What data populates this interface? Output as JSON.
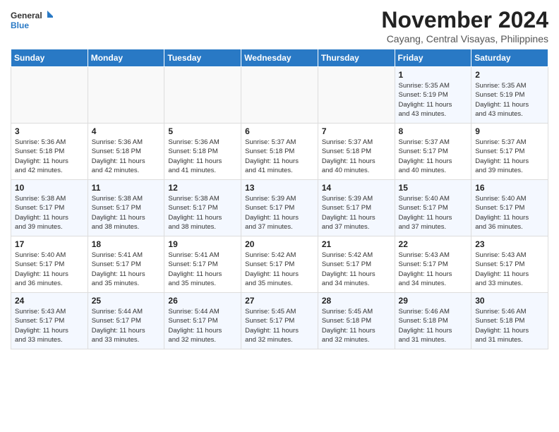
{
  "logo": {
    "line1": "General",
    "line2": "Blue"
  },
  "title": "November 2024",
  "location": "Cayang, Central Visayas, Philippines",
  "weekdays": [
    "Sunday",
    "Monday",
    "Tuesday",
    "Wednesday",
    "Thursday",
    "Friday",
    "Saturday"
  ],
  "weeks": [
    [
      {
        "day": "",
        "info": ""
      },
      {
        "day": "",
        "info": ""
      },
      {
        "day": "",
        "info": ""
      },
      {
        "day": "",
        "info": ""
      },
      {
        "day": "",
        "info": ""
      },
      {
        "day": "1",
        "info": "Sunrise: 5:35 AM\nSunset: 5:19 PM\nDaylight: 11 hours\nand 43 minutes."
      },
      {
        "day": "2",
        "info": "Sunrise: 5:35 AM\nSunset: 5:19 PM\nDaylight: 11 hours\nand 43 minutes."
      }
    ],
    [
      {
        "day": "3",
        "info": "Sunrise: 5:36 AM\nSunset: 5:18 PM\nDaylight: 11 hours\nand 42 minutes."
      },
      {
        "day": "4",
        "info": "Sunrise: 5:36 AM\nSunset: 5:18 PM\nDaylight: 11 hours\nand 42 minutes."
      },
      {
        "day": "5",
        "info": "Sunrise: 5:36 AM\nSunset: 5:18 PM\nDaylight: 11 hours\nand 41 minutes."
      },
      {
        "day": "6",
        "info": "Sunrise: 5:37 AM\nSunset: 5:18 PM\nDaylight: 11 hours\nand 41 minutes."
      },
      {
        "day": "7",
        "info": "Sunrise: 5:37 AM\nSunset: 5:18 PM\nDaylight: 11 hours\nand 40 minutes."
      },
      {
        "day": "8",
        "info": "Sunrise: 5:37 AM\nSunset: 5:17 PM\nDaylight: 11 hours\nand 40 minutes."
      },
      {
        "day": "9",
        "info": "Sunrise: 5:37 AM\nSunset: 5:17 PM\nDaylight: 11 hours\nand 39 minutes."
      }
    ],
    [
      {
        "day": "10",
        "info": "Sunrise: 5:38 AM\nSunset: 5:17 PM\nDaylight: 11 hours\nand 39 minutes."
      },
      {
        "day": "11",
        "info": "Sunrise: 5:38 AM\nSunset: 5:17 PM\nDaylight: 11 hours\nand 38 minutes."
      },
      {
        "day": "12",
        "info": "Sunrise: 5:38 AM\nSunset: 5:17 PM\nDaylight: 11 hours\nand 38 minutes."
      },
      {
        "day": "13",
        "info": "Sunrise: 5:39 AM\nSunset: 5:17 PM\nDaylight: 11 hours\nand 37 minutes."
      },
      {
        "day": "14",
        "info": "Sunrise: 5:39 AM\nSunset: 5:17 PM\nDaylight: 11 hours\nand 37 minutes."
      },
      {
        "day": "15",
        "info": "Sunrise: 5:40 AM\nSunset: 5:17 PM\nDaylight: 11 hours\nand 37 minutes."
      },
      {
        "day": "16",
        "info": "Sunrise: 5:40 AM\nSunset: 5:17 PM\nDaylight: 11 hours\nand 36 minutes."
      }
    ],
    [
      {
        "day": "17",
        "info": "Sunrise: 5:40 AM\nSunset: 5:17 PM\nDaylight: 11 hours\nand 36 minutes."
      },
      {
        "day": "18",
        "info": "Sunrise: 5:41 AM\nSunset: 5:17 PM\nDaylight: 11 hours\nand 35 minutes."
      },
      {
        "day": "19",
        "info": "Sunrise: 5:41 AM\nSunset: 5:17 PM\nDaylight: 11 hours\nand 35 minutes."
      },
      {
        "day": "20",
        "info": "Sunrise: 5:42 AM\nSunset: 5:17 PM\nDaylight: 11 hours\nand 35 minutes."
      },
      {
        "day": "21",
        "info": "Sunrise: 5:42 AM\nSunset: 5:17 PM\nDaylight: 11 hours\nand 34 minutes."
      },
      {
        "day": "22",
        "info": "Sunrise: 5:43 AM\nSunset: 5:17 PM\nDaylight: 11 hours\nand 34 minutes."
      },
      {
        "day": "23",
        "info": "Sunrise: 5:43 AM\nSunset: 5:17 PM\nDaylight: 11 hours\nand 33 minutes."
      }
    ],
    [
      {
        "day": "24",
        "info": "Sunrise: 5:43 AM\nSunset: 5:17 PM\nDaylight: 11 hours\nand 33 minutes."
      },
      {
        "day": "25",
        "info": "Sunrise: 5:44 AM\nSunset: 5:17 PM\nDaylight: 11 hours\nand 33 minutes."
      },
      {
        "day": "26",
        "info": "Sunrise: 5:44 AM\nSunset: 5:17 PM\nDaylight: 11 hours\nand 32 minutes."
      },
      {
        "day": "27",
        "info": "Sunrise: 5:45 AM\nSunset: 5:17 PM\nDaylight: 11 hours\nand 32 minutes."
      },
      {
        "day": "28",
        "info": "Sunrise: 5:45 AM\nSunset: 5:18 PM\nDaylight: 11 hours\nand 32 minutes."
      },
      {
        "day": "29",
        "info": "Sunrise: 5:46 AM\nSunset: 5:18 PM\nDaylight: 11 hours\nand 31 minutes."
      },
      {
        "day": "30",
        "info": "Sunrise: 5:46 AM\nSunset: 5:18 PM\nDaylight: 11 hours\nand 31 minutes."
      }
    ]
  ]
}
